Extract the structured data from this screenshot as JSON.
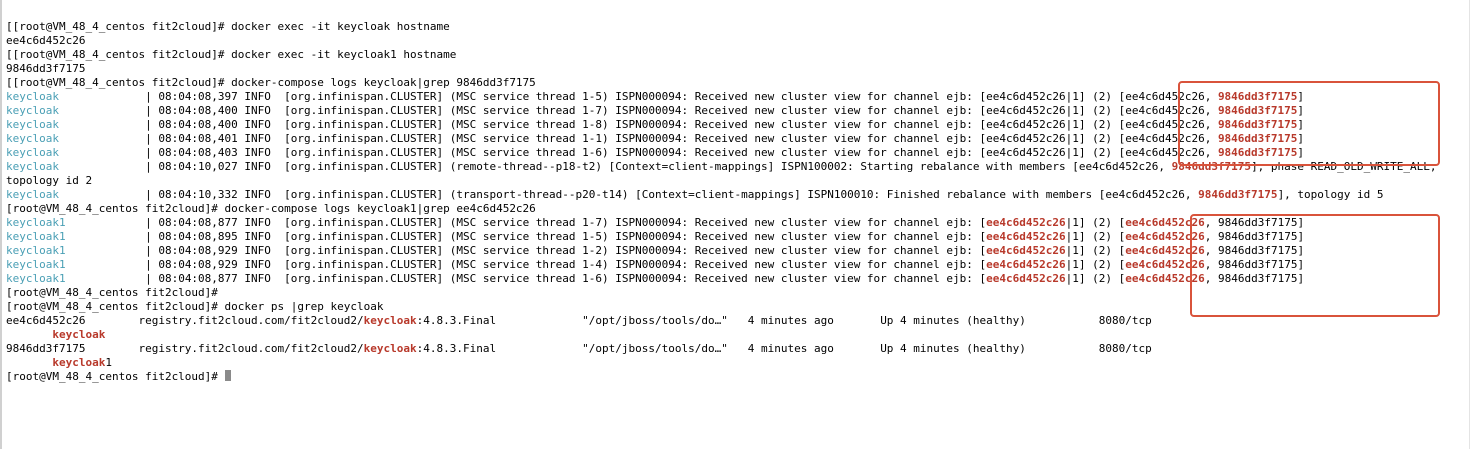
{
  "colors": {
    "service": "#4a9fb5",
    "highlight": "#b8392b",
    "annotation_box": "#d9533b",
    "cursor": "#8a8a8a"
  },
  "lines": [
    {
      "id": "l1",
      "segs": [
        {
          "t": "[[root@VM_48_4_centos fit2cloud]# docker exec -it keycloak hostname"
        }
      ]
    },
    {
      "id": "l2",
      "segs": [
        {
          "t": "ee4c6d452c26"
        }
      ]
    },
    {
      "id": "l3",
      "segs": [
        {
          "t": "[[root@VM_48_4_centos fit2cloud]# docker exec -it keycloak1 hostname"
        }
      ]
    },
    {
      "id": "l4",
      "segs": [
        {
          "t": "9846dd3f7175"
        }
      ]
    },
    {
      "id": "l5",
      "segs": [
        {
          "t": "[[root@VM_48_4_centos fit2cloud]# docker-compose logs keycloak|grep 9846dd3f7175"
        }
      ]
    },
    {
      "id": "l6",
      "segs": [
        {
          "t": "keycloak             ",
          "c": "svc"
        },
        {
          "t": "| 08:04:08,397 INFO  [org.infinispan.CLUSTER] (MSC service thread 1-5) ISPN000094: Received new cluster view for channel ejb: [ee4c6d452c26|1] (2) [ee4c6d452c26, "
        },
        {
          "t": "9846dd3f7175",
          "c": "hl"
        },
        {
          "t": "]"
        }
      ]
    },
    {
      "id": "l7",
      "segs": [
        {
          "t": "keycloak             ",
          "c": "svc"
        },
        {
          "t": "| 08:04:08,400 INFO  [org.infinispan.CLUSTER] (MSC service thread 1-7) ISPN000094: Received new cluster view for channel ejb: [ee4c6d452c26|1] (2) [ee4c6d452c26, "
        },
        {
          "t": "9846dd3f7175",
          "c": "hl"
        },
        {
          "t": "]"
        }
      ]
    },
    {
      "id": "l8",
      "segs": [
        {
          "t": "keycloak             ",
          "c": "svc"
        },
        {
          "t": "| 08:04:08,400 INFO  [org.infinispan.CLUSTER] (MSC service thread 1-8) ISPN000094: Received new cluster view for channel ejb: [ee4c6d452c26|1] (2) [ee4c6d452c26, "
        },
        {
          "t": "9846dd3f7175",
          "c": "hl"
        },
        {
          "t": "]"
        }
      ]
    },
    {
      "id": "l9",
      "segs": [
        {
          "t": "keycloak             ",
          "c": "svc"
        },
        {
          "t": "| 08:04:08,401 INFO  [org.infinispan.CLUSTER] (MSC service thread 1-1) ISPN000094: Received new cluster view for channel ejb: [ee4c6d452c26|1] (2) [ee4c6d452c26, "
        },
        {
          "t": "9846dd3f7175",
          "c": "hl"
        },
        {
          "t": "]"
        }
      ]
    },
    {
      "id": "l10",
      "segs": [
        {
          "t": "keycloak             ",
          "c": "svc"
        },
        {
          "t": "| 08:04:08,403 INFO  [org.infinispan.CLUSTER] (MSC service thread 1-6) ISPN000094: Received new cluster view for channel ejb: [ee4c6d452c26|1] (2) [ee4c6d452c26, "
        },
        {
          "t": "9846dd3f7175",
          "c": "hl"
        },
        {
          "t": "]"
        }
      ]
    },
    {
      "id": "l11",
      "wrap": true,
      "segs": [
        {
          "t": "keycloak             ",
          "c": "svc"
        },
        {
          "t": "| 08:04:10,027 INFO  [org.infinispan.CLUSTER] (remote-thread--p18-t2) [Context=client-mappings] ISPN100002: Starting rebalance with members [ee4c6d452c26, "
        },
        {
          "t": "9846dd3f7175",
          "c": "hl"
        },
        {
          "t": "], phase READ_OLD_WRITE_ALL, topology id 2"
        }
      ]
    },
    {
      "id": "l12",
      "wrap": true,
      "segs": [
        {
          "t": "keycloak             ",
          "c": "svc"
        },
        {
          "t": "| 08:04:10,332 INFO  [org.infinispan.CLUSTER] (transport-thread--p20-t14) [Context=client-mappings] ISPN100010: Finished rebalance with members [ee4c6d452c26, "
        },
        {
          "t": "9846dd3f7175",
          "c": "hl"
        },
        {
          "t": "], topology id 5"
        }
      ]
    },
    {
      "id": "l13",
      "segs": [
        {
          "t": "[root@VM_48_4_centos fit2cloud]# docker-compose logs keycloak1|grep ee4c6d452c26"
        }
      ]
    },
    {
      "id": "l14",
      "segs": [
        {
          "t": "keycloak1            ",
          "c": "svc"
        },
        {
          "t": "| 08:04:08,877 INFO  [org.infinispan.CLUSTER] (MSC service thread 1-7) ISPN000094: Received new cluster view for channel ejb: ["
        },
        {
          "t": "ee4c6d452c26",
          "c": "hl"
        },
        {
          "t": "|1] (2) ["
        },
        {
          "t": "ee4c6d452c26",
          "c": "hl"
        },
        {
          "t": ", 9846dd3f7175]"
        }
      ]
    },
    {
      "id": "l15",
      "segs": [
        {
          "t": "keycloak1            ",
          "c": "svc"
        },
        {
          "t": "| 08:04:08,895 INFO  [org.infinispan.CLUSTER] (MSC service thread 1-5) ISPN000094: Received new cluster view for channel ejb: ["
        },
        {
          "t": "ee4c6d452c26",
          "c": "hl"
        },
        {
          "t": "|1] (2) ["
        },
        {
          "t": "ee4c6d452c26",
          "c": "hl"
        },
        {
          "t": ", 9846dd3f7175]"
        }
      ]
    },
    {
      "id": "l16",
      "segs": [
        {
          "t": "keycloak1            ",
          "c": "svc"
        },
        {
          "t": "| 08:04:08,929 INFO  [org.infinispan.CLUSTER] (MSC service thread 1-2) ISPN000094: Received new cluster view for channel ejb: ["
        },
        {
          "t": "ee4c6d452c26",
          "c": "hl"
        },
        {
          "t": "|1] (2) ["
        },
        {
          "t": "ee4c6d452c26",
          "c": "hl"
        },
        {
          "t": ", 9846dd3f7175]"
        }
      ]
    },
    {
      "id": "l17",
      "segs": [
        {
          "t": "keycloak1            ",
          "c": "svc"
        },
        {
          "t": "| 08:04:08,929 INFO  [org.infinispan.CLUSTER] (MSC service thread 1-4) ISPN000094: Received new cluster view for channel ejb: ["
        },
        {
          "t": "ee4c6d452c26",
          "c": "hl"
        },
        {
          "t": "|1] (2) ["
        },
        {
          "t": "ee4c6d452c26",
          "c": "hl"
        },
        {
          "t": ", 9846dd3f7175]"
        }
      ]
    },
    {
      "id": "l18",
      "segs": [
        {
          "t": "keycloak1            ",
          "c": "svc"
        },
        {
          "t": "| 08:04:08,877 INFO  [org.infinispan.CLUSTER] (MSC service thread 1-6) ISPN000094: Received new cluster view for channel ejb: ["
        },
        {
          "t": "ee4c6d452c26",
          "c": "hl"
        },
        {
          "t": "|1] (2) ["
        },
        {
          "t": "ee4c6d452c26",
          "c": "hl"
        },
        {
          "t": ", 9846dd3f7175]"
        }
      ]
    },
    {
      "id": "l19",
      "segs": [
        {
          "t": "[root@VM_48_4_centos fit2cloud]#"
        }
      ]
    },
    {
      "id": "l20",
      "segs": [
        {
          "t": "[root@VM_48_4_centos fit2cloud]# docker ps |grep keycloak"
        }
      ]
    },
    {
      "id": "l21",
      "segs": [
        {
          "t": "ee4c6d452c26        registry.fit2cloud.com/fit2cloud2/"
        },
        {
          "t": "keycloak",
          "c": "hl"
        },
        {
          "t": ":4.8.3.Final             \"/opt/jboss/tools/do…\"   4 minutes ago       Up 4 minutes (healthy)           8080/tcp"
        }
      ]
    },
    {
      "id": "l22",
      "segs": [
        {
          "t": "       "
        },
        {
          "t": "keycloak",
          "c": "hl"
        }
      ]
    },
    {
      "id": "l23",
      "segs": [
        {
          "t": "9846dd3f7175        registry.fit2cloud.com/fit2cloud2/"
        },
        {
          "t": "keycloak",
          "c": "hl"
        },
        {
          "t": ":4.8.3.Final             \"/opt/jboss/tools/do…\"   4 minutes ago       Up 4 minutes (healthy)           8080/tcp"
        }
      ]
    },
    {
      "id": "l24",
      "segs": [
        {
          "t": "       "
        },
        {
          "t": "keycloak",
          "c": "hl"
        },
        {
          "t": "1"
        }
      ]
    },
    {
      "id": "l25",
      "prompt": true,
      "segs": [
        {
          "t": "[root@VM_48_4_centos fit2cloud]# "
        }
      ]
    }
  ]
}
